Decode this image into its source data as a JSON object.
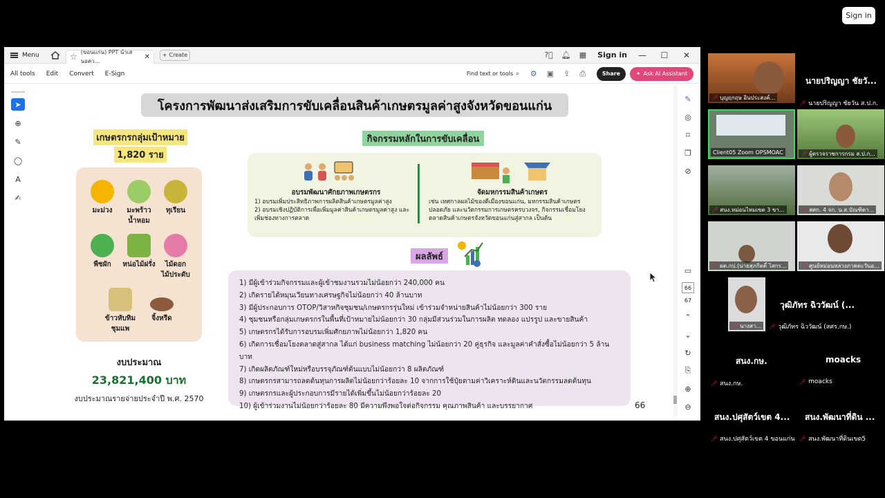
{
  "signin": "Sign in",
  "acrobat": {
    "menu": "Menu",
    "tab_title": "(ขอนแก่น) PPT นำเสนอคว...",
    "create": "Create",
    "sign_in": "Sign in",
    "toolbar": [
      "All tools",
      "Edit",
      "Convert",
      "E-Sign"
    ],
    "find": "Find text or tools",
    "share": "Share",
    "ai": "Ask AI Assistant",
    "page_box": "66",
    "page_label": "67"
  },
  "slide": {
    "title": "โครงการพัฒนาส่งเสริมการขับเคลื่อนสินค้าเกษตรมูลค่าสูงจังหวัดขอนแก่น",
    "target_title": "เกษตรกรกลุ่มเป้าหมาย",
    "target_count": "1,820 ราย",
    "crops": [
      "มะม่วง",
      "มะพร้าว\nน้ำหอม",
      "ทุเรียน",
      "พืชผัก",
      "หน่อไม้ฝรั่ง",
      "ไม้ดอก\nไม้ประดับ",
      "ข้าวหับทิม\nชุมแพ",
      "จิ้งหรีด"
    ],
    "budget_label": "งบประมาณ",
    "budget_value": "23,821,400 บาท",
    "budget_note": "งบประมาณรายจ่ายประจำปี พ.ศ. 2570",
    "activity_title": "กิจกรรมหลักในการขับเคลื่อน",
    "activity1_head": "อบรมพัฒนาศักยภาพเกษตรกร",
    "activity1_body": "1) อบรมเพิ่มประสิทธิภาพการผลิตสินค้าเกษตรมูลค่าสูง\n2) อบรมเชิงปฏิบัติการเพื่อเพิ่มมูลค่าสินค้าเกษตรมูลค่าสูง และเพิ่มช่องทางการตลาด",
    "activity2_head": "จัดมหกรรมสินค้าเกษตร",
    "activity2_body": "เช่น เทศกาลผลไม้ของดีเมืองขอนแก่น, มหกรรมสินค้าเกษตรปลอดภัย และนวัตกรรมการเกษตรครบวงจร, กิจกรรมเชื่อมโยงตลาดสินค้าเกษตรจังหวัดขอนแก่นสู่สากล เป็นต้น",
    "result_title": "ผลลัพธ์",
    "results": [
      "1) มีผู้เข้าร่วมกิจกรรมและผู้เข้าชมงานรวมไม่น้อยกว่า 240,000 คน",
      "2) เกิดรายได้หมุนเวียนทางเศรษฐกิจไม่น้อยกว่า 40 ล้านบาท",
      "3) มีผู้ประกอบการ OTOP/วิสาหกิจชุมชน/เกษตรกรรุ่นใหม่ เข้าร่วมจำหน่ายสินค้าไม่น้อยกว่า 300 ราย",
      "4) ชุมชนหรือกลุ่มเกษตรกรในพื้นที่เป้าหมายไม่น้อยกว่า 30 กลุ่มมีส่วนร่วมในการผลิต ทดลอง แปรรูป และขายสินค้า",
      "5) เกษตรกรได้รับการอบรมเพิ่มศักยภาพไม่น้อยกว่า 1,820 คน",
      "6) เกิดการเชื่อมโยงตลาดสู่สากล ได้แก่ business matching ไม่น้อยกว่า 20 คู่ธุรกิจ และมูลค่าคำสั่งซื้อไม่น้อยกว่า 5 ล้านบาท",
      "7) เกิดผลิตภัณฑ์ใหม่หรือบรรจุภัณฑ์ต้นแบบไม่น้อยกว่า 8 ผลิตภัณฑ์",
      "8) เกษตรกรสามารถลดต้นทุนการผลิตไม่น้อยกว่าร้อยละ 10 จากการใช้ปุ๋ยตามค่าวิเคราะห์ดินและนวัตกรรมลดต้นทุน",
      "9) เกษตรกรและผู้ประกอบการมีรายได้เพิ่มขึ้นไม่น้อยกว่าร้อยละ 20",
      "10) ผู้เข้าร่วมงานไม่น้อยกว่าร้อยละ 80 มีความพึงพอใจต่อกิจกรรม คุณภาพสินค้า และบรรยากาศ"
    ],
    "page_number": "66"
  },
  "participants": {
    "p1_label": "บุญฤกฤษ อินประสงค์...",
    "p2_big": "นายปริญญา ชัยวั...",
    "p2_label": "นายปริญญา ชัยวัน ส.ป.ก.",
    "p3_label": "Client05 Zoom OPSMOAC",
    "p4_label": "ผู้ตรวจราชการกรม ส.ป.ก...",
    "p5_label": "สนง.หม่อนไหมเขต 3 ขา...",
    "p6_label": "สศก. 4 จก. น.ส.บัณฑิตา...",
    "p7_label": "ผต.กป.(นายสุภกิตติ์ ไสกร...",
    "p8_label": "ศูนย์หม่อนหลวงภาคตะวันอ...",
    "p9_label": "นางสา...",
    "p10_big": "วุฒิภัทร ฉิววัฒน์ (...",
    "p10_label": "วุฒิภัทร ฉิววัฒน์ (สศร.กษ.)",
    "p11_big": "สนง.กษ.",
    "p11_label": "สนง.กษ.",
    "p12_big": "moacks",
    "p12_label": "moacks",
    "p13_big": "สนง.ปศุสัตว์เขต 4...",
    "p13_label": "สนง.ปศุสัตว์เขต 4 ขอนแก่น",
    "p14_big": "สนง.พัฒนาที่ดิน ...",
    "p14_label": "สนง.พัฒนาที่ดินเขต5"
  }
}
